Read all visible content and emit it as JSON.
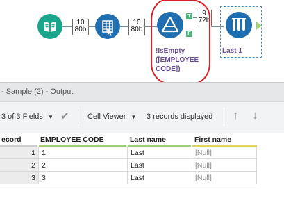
{
  "canvas": {
    "tools": [
      {
        "name": "input-data-tool",
        "icon": "book-icon",
        "color": "#18a58c"
      },
      {
        "name": "select-tool",
        "icon": "table-columns-icon",
        "color": "#1f6fb0"
      },
      {
        "name": "filter-tool",
        "icon": "filter-triangle-icon",
        "color": "#1f6fb0"
      },
      {
        "name": "browse-tool",
        "icon": "test-tubes-icon",
        "color": "#1f6fb0"
      }
    ],
    "count_1": {
      "top": "10",
      "bottom": "80b"
    },
    "count_2": {
      "top": "10",
      "bottom": "80b"
    },
    "count_3": {
      "top": "9",
      "bottom": "72b"
    },
    "filter_true_anchor": "T",
    "filter_false_anchor": "F",
    "filter_label_lines": [
      "!IsEmpty",
      "([EMPLOYEE",
      "CODE])"
    ],
    "browse_label": "Last 1",
    "annotation_color": "#d62026"
  },
  "results": {
    "title": "- Sample (2) - Output",
    "fields_label": "3 of 3 Fields",
    "cell_viewer_label": "Cell Viewer",
    "records_label": "3 records displayed",
    "columns": [
      "ecord",
      "EMPLOYEE CODE",
      "Last name",
      "First name"
    ],
    "column_colors": [
      "#cccccc",
      "#9bd174",
      "#9bd174",
      "#e6d257"
    ],
    "rows": [
      {
        "record": "1",
        "employee_code": "1",
        "last_name": "Last",
        "first_name": "[Null]"
      },
      {
        "record": "2",
        "employee_code": "2",
        "last_name": "Last",
        "first_name": "[Null]"
      },
      {
        "record": "3",
        "employee_code": "3",
        "last_name": "Last",
        "first_name": "[Null]"
      }
    ]
  }
}
